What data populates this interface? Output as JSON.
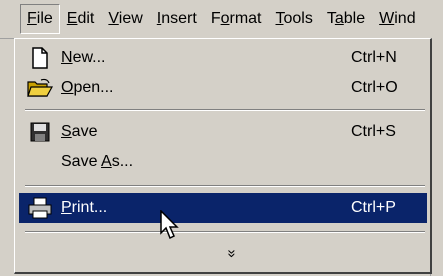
{
  "menubar": {
    "items": [
      {
        "label": "File"
      },
      {
        "label": "Edit"
      },
      {
        "label": "View"
      },
      {
        "label": "Insert"
      },
      {
        "label": "Format"
      },
      {
        "label": "Tools"
      },
      {
        "label": "Table"
      },
      {
        "label": "Wind"
      }
    ]
  },
  "file_menu": {
    "items": [
      {
        "label": "New...",
        "shortcut": "Ctrl+N",
        "icon": "new-document-icon"
      },
      {
        "label": "Open...",
        "shortcut": "Ctrl+O",
        "icon": "open-folder-icon"
      },
      {
        "label": "Save",
        "shortcut": "Ctrl+S",
        "icon": "save-disk-icon"
      },
      {
        "label": "Save As...",
        "shortcut": ""
      },
      {
        "label": "Print...",
        "shortcut": "Ctrl+P",
        "icon": "printer-icon",
        "highlighted": true
      }
    ],
    "expand_glyph": "»"
  },
  "colors": {
    "menu_bg": "#d4d0c8",
    "highlight": "#0a246a"
  }
}
